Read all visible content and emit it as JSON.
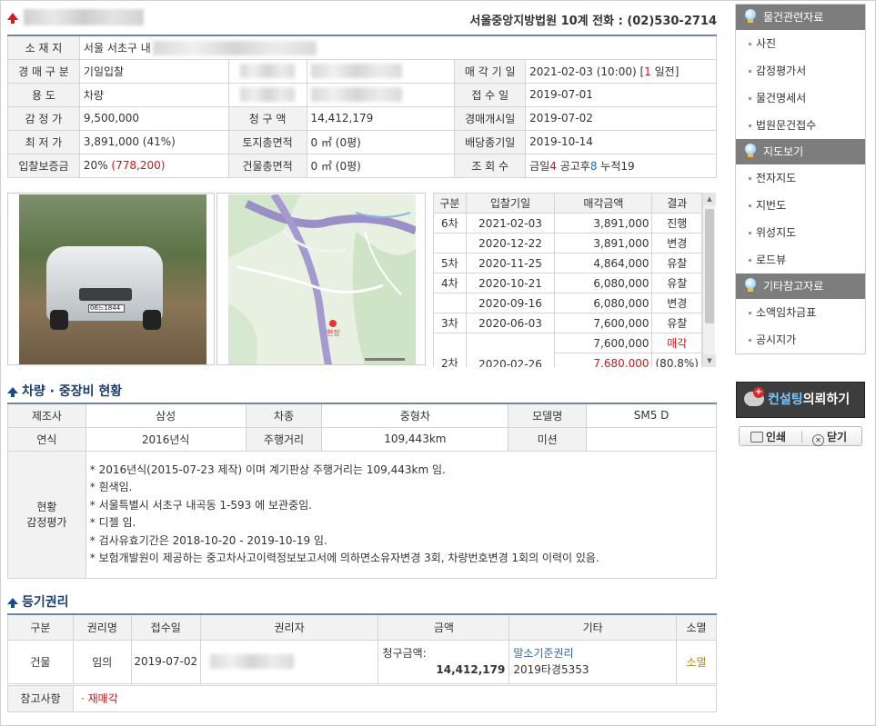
{
  "header": {
    "court_line": "서울중앙지방법원 10계  전화 : (02)530-2714"
  },
  "info": {
    "location_label": "소 재 지",
    "location_value": "서울 서초구 내",
    "auction_type_label": "경 매 구 분",
    "auction_type_value": "기일입찰",
    "usage_label": "용       도",
    "usage_value": "차량",
    "appraisal_label": "감 정 가",
    "appraisal_value": "9,500,000",
    "claim_label": "청 구 액",
    "claim_value": "14,412,179",
    "min_label": "최 저 가",
    "min_value": "3,891,000 (41%)",
    "land_area_label": "토지총면적",
    "land_area_value": "0 ㎡ (0평)",
    "deposit_label": "입찰보증금",
    "deposit_pct": "20% ",
    "deposit_amount": "(778,200)",
    "building_area_label": "건물총면적",
    "building_area_value": "0 ㎡ (0평)",
    "sale_date_label": "매 각 기 일",
    "sale_date_value": "2021-02-03 (10:00) [",
    "sale_date_days": "1",
    "sale_date_suffix": " 일전]",
    "receipt_label": "접 수 일",
    "receipt_value": "2019-07-01",
    "start_label": "경매개시일",
    "start_value": "2019-07-02",
    "dividend_label": "배당종기일",
    "dividend_value": "2019-10-14",
    "views_label": "조 회 수",
    "views_today_label": "금일",
    "views_today": "4",
    "views_after_label": " 공고후",
    "views_after": "8",
    "views_total_label": " 누적",
    "views_total": "19"
  },
  "rounds": {
    "headers": [
      "구분",
      "입찰기일",
      "매각금액",
      "결과"
    ],
    "rows": [
      {
        "round": "6차",
        "date": "2021-02-03",
        "amount": "3,891,000",
        "result": "진행"
      },
      {
        "round": "",
        "date": "2020-12-22",
        "amount": "3,891,000",
        "result": "변경"
      },
      {
        "round": "5차",
        "date": "2020-11-25",
        "amount": "4,864,000",
        "result": "유찰"
      },
      {
        "round": "4차",
        "date": "2020-10-21",
        "amount": "6,080,000",
        "result": "유찰"
      },
      {
        "round": "",
        "date": "2020-09-16",
        "amount": "6,080,000",
        "result": "변경"
      },
      {
        "round": "3차",
        "date": "2020-06-03",
        "amount": "7,600,000",
        "result": "유찰"
      }
    ],
    "last": {
      "round": "2차",
      "date": "2020-02-26",
      "amount": "7,600,000",
      "result": "매각",
      "sold_amount": "7,680,000",
      "sold_pct": "(80.8%)"
    }
  },
  "vehicle_section": {
    "title": "차량 · 중장비 현황",
    "maker_label": "제조사",
    "maker_value": "삼성",
    "type_label": "차종",
    "type_value": "중형차",
    "model_label": "모델명",
    "model_value": "SM5 D",
    "year_label": "연식",
    "year_value": "2016년식",
    "mileage_label": "주행거리",
    "mileage_value": "109,443km",
    "trans_label": "미션",
    "trans_value": "",
    "status_label_1": "현황",
    "status_label_2": "감정평가",
    "notes": [
      "* 2016년식(2015-07-23 제작) 이며 계기판상 주행거리는 109,443km 임.",
      "* 흰색임.",
      "* 서울특별시 서초구 내곡동 1-593 에 보관중임.",
      "* 디젤 임.",
      "* 검사유효기간은 2018-10-20 - 2019-10-19 임.",
      "* 보험개발원이 제공하는 중고차사고이력정보보고서에 의하면소유자변경 3회, 차량번호변경 1회의 이력이 있음."
    ]
  },
  "registry_section": {
    "title": "등기권리",
    "headers": [
      "구분",
      "권리명",
      "접수일",
      "권리자",
      "금액",
      "기타",
      "소멸"
    ],
    "row": {
      "kind": "건물",
      "right": "임의",
      "date": "2019-07-02",
      "amount_label": "청구금액:",
      "amount": "14,412,179",
      "etc_link": "말소기준권리",
      "etc_case": "2019타경5353",
      "extinct": "소멸"
    },
    "note_label": "참고사항",
    "note_value": "· 재매각"
  },
  "sidebar": {
    "group1_title": "물건관련자료",
    "group1_items": [
      "사진",
      "감정평가서",
      "물건명세서",
      "법원문건접수"
    ],
    "group2_title": "지도보기",
    "group2_items": [
      "전자지도",
      "지번도",
      "위성지도",
      "로드뷰"
    ],
    "group3_title": "기타참고자료",
    "group3_items": [
      "소액임차금표",
      "공시지가"
    ],
    "consult_hl": "컨설팅",
    "consult_rest": "의뢰하기",
    "print_label": "인쇄",
    "close_label": "닫기"
  },
  "photo": {
    "plate_text": "06느1844"
  },
  "map": {
    "marker_text": "현장"
  }
}
